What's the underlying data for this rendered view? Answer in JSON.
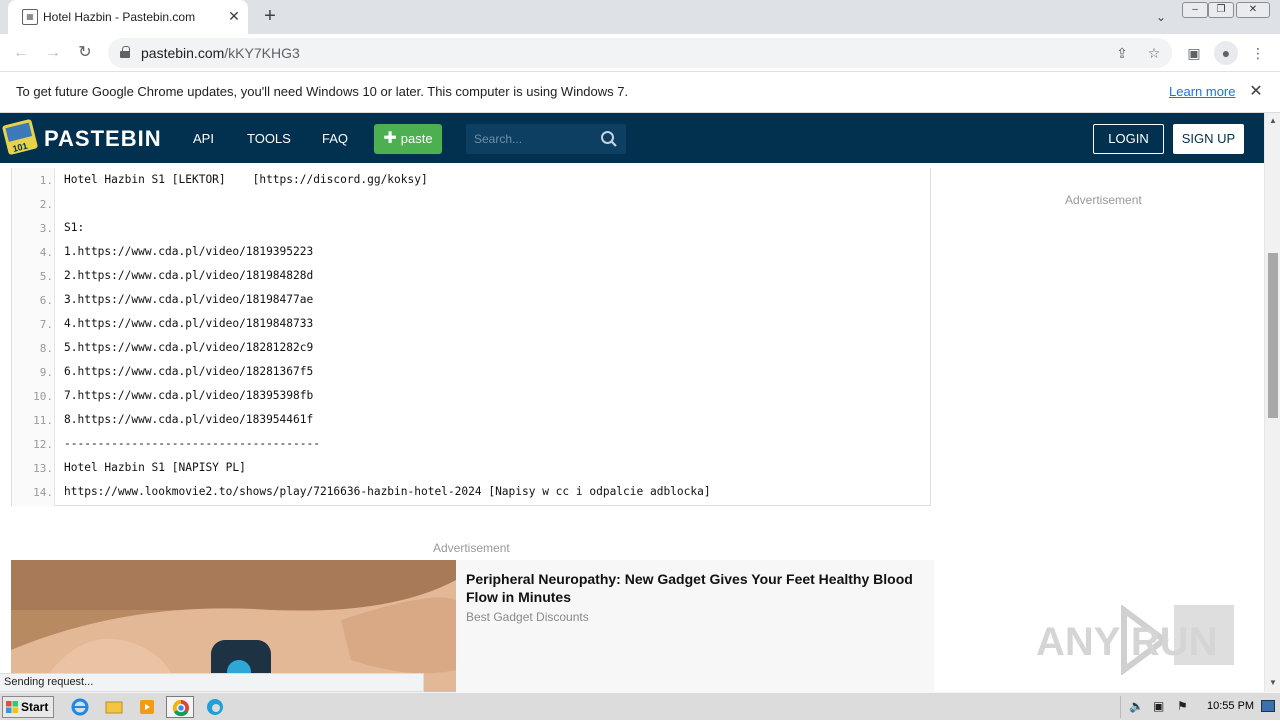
{
  "browser": {
    "tab_title": "Hotel Hazbin - Pastebin.com",
    "url_domain": "pastebin.com",
    "url_path": "/kKY7KHG3",
    "infobar_text": "To get future Google Chrome updates, you'll need Windows 10 or later. This computer is using Windows 7.",
    "infobar_link": "Learn more",
    "status_text": "Sending request..."
  },
  "header": {
    "brand": "PASTEBIN",
    "nav": [
      "API",
      "TOOLS",
      "FAQ"
    ],
    "paste_label": "paste",
    "search_placeholder": "Search...",
    "login_label": "LOGIN",
    "signup_label": "SIGN UP"
  },
  "code": {
    "lines": [
      {
        "n": "1.",
        "text": "Hotel Hazbin S1 [LEKTOR]    [https://discord.gg/koksy]"
      },
      {
        "n": "2.",
        "text": ""
      },
      {
        "n": "3.",
        "text": "S1:"
      },
      {
        "n": "4.",
        "text": "1.https://www.cda.pl/video/1819395223"
      },
      {
        "n": "5.",
        "text": "2.https://www.cda.pl/video/181984828d"
      },
      {
        "n": "6.",
        "text": "3.https://www.cda.pl/video/18198477ae"
      },
      {
        "n": "7.",
        "text": "4.https://www.cda.pl/video/1819848733"
      },
      {
        "n": "8.",
        "text": "5.https://www.cda.pl/video/18281282c9"
      },
      {
        "n": "9.",
        "text": "6.https://www.cda.pl/video/18281367f5"
      },
      {
        "n": "10.",
        "text": "7.https://www.cda.pl/video/18395398fb"
      },
      {
        "n": "11.",
        "text": "8.https://www.cda.pl/video/183954461f"
      },
      {
        "n": "12.",
        "text": "--------------------------------------"
      },
      {
        "n": "13.",
        "text": "Hotel Hazbin S1 [NAPISY PL]"
      },
      {
        "n": "14.",
        "text": "https://www.lookmovie2.to/shows/play/7216636-hazbin-hotel-2024 [Napisy w cc i odpalcie adblocka]"
      }
    ]
  },
  "sidebar": {
    "ad_label": "Advertisement"
  },
  "ad": {
    "label": "Advertisement",
    "title": "Peripheral Neuropathy: New Gadget Gives Your Feet Healthy Blood Flow in Minutes",
    "source": "Best Gadget Discounts"
  },
  "watermark": "ANY RUN",
  "taskbar": {
    "start_label": "Start",
    "clock": "10:55 PM"
  },
  "colors": {
    "header_bg": "#02304f",
    "paste_btn": "#4caf50",
    "link": "#1a73e8"
  }
}
